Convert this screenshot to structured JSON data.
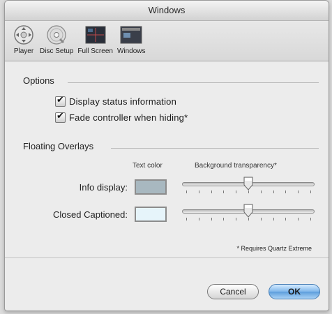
{
  "window": {
    "title": "Windows"
  },
  "toolbar": {
    "items": [
      {
        "label": "Player",
        "icon": "player-icon"
      },
      {
        "label": "Disc Setup",
        "icon": "disc-setup-icon"
      },
      {
        "label": "Full Screen",
        "icon": "full-screen-icon"
      },
      {
        "label": "Windows",
        "icon": "windows-icon"
      }
    ]
  },
  "options": {
    "title": "Options",
    "checkboxes": [
      {
        "label": "Display status information",
        "checked": true
      },
      {
        "label": "Fade controller when hiding*",
        "checked": true
      }
    ]
  },
  "overlays": {
    "title": "Floating Overlays",
    "col_text_color": "Text color",
    "col_bg_transparency": "Background transparency*",
    "rows": [
      {
        "label": "Info display:",
        "swatch_color": "#a8b8c0",
        "transparency": 0.5
      },
      {
        "label": "Closed Captioned:",
        "swatch_color": "#e6f4fa",
        "transparency": 0.5
      }
    ],
    "footnote": "* Requires Quartz Extreme"
  },
  "buttons": {
    "cancel": "Cancel",
    "ok": "OK"
  }
}
